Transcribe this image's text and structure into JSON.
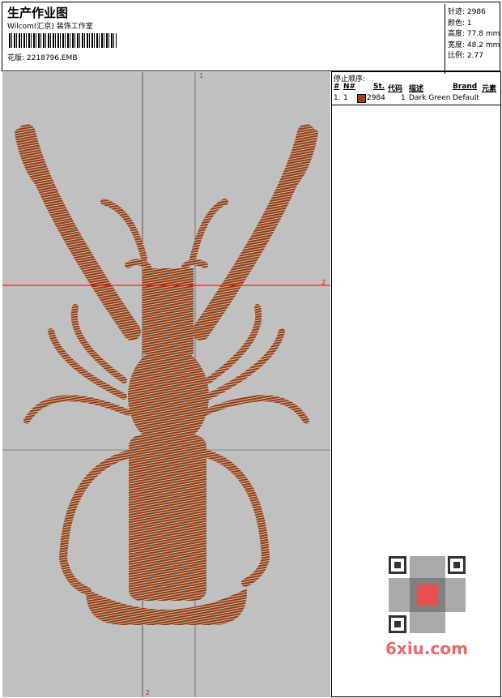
{
  "header": {
    "title": "生产作业图",
    "company": "Wilcom(汇京) 装饰工作室",
    "design_label": "花版:",
    "design_file": "2218796.EMB"
  },
  "stats": [
    {
      "label": "针迹:",
      "value": "2986"
    },
    {
      "label": "颜色:",
      "value": "1"
    },
    {
      "label": "高度:",
      "value": "77.8 mm"
    },
    {
      "label": "宽度:",
      "value": "48.2 mm"
    },
    {
      "label": "比例:",
      "value": "2.77"
    }
  ],
  "stop_sequence": {
    "title": "停止顺序:",
    "columns": [
      "#",
      "N#",
      "St.",
      "代码",
      "描述",
      "Brand",
      "元素"
    ],
    "rows": [
      {
        "num": "1.",
        "n": "1",
        "color": "#a33a10",
        "stitches": "2984",
        "code": "1",
        "desc": "Dark Green",
        "brand": "Default"
      }
    ]
  },
  "canvas": {
    "marker_top": "1",
    "marker_right": "2",
    "marker_bottom": "2",
    "thread_color": "#9a3a0a"
  },
  "watermark": "6xiu.com"
}
